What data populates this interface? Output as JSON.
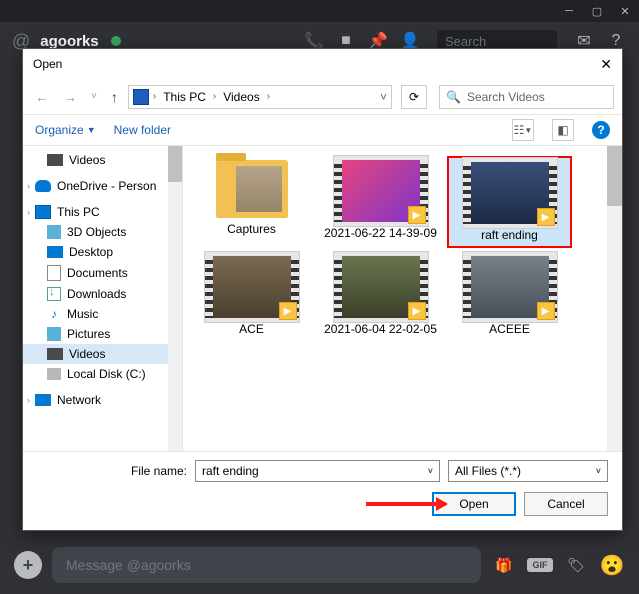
{
  "discord": {
    "username": "agoorks",
    "search_placeholder": "Search",
    "message_placeholder": "Message @agoorks",
    "gif_label": "GIF"
  },
  "dialog": {
    "title": "Open",
    "breadcrumbs": [
      "This PC",
      "Videos"
    ],
    "search_placeholder": "Search Videos",
    "toolbar": {
      "organize": "Organize",
      "new_folder": "New folder"
    },
    "tree": [
      {
        "label": "Videos",
        "icon": "vid",
        "indent": 1
      },
      {
        "label": "OneDrive - Person",
        "icon": "onedrive",
        "indent": 0,
        "exp": true
      },
      {
        "label": "This PC",
        "icon": "pc",
        "indent": 0,
        "exp": true
      },
      {
        "label": "3D Objects",
        "icon": "3d",
        "indent": 1
      },
      {
        "label": "Desktop",
        "icon": "desk",
        "indent": 1
      },
      {
        "label": "Documents",
        "icon": "doc",
        "indent": 1
      },
      {
        "label": "Downloads",
        "icon": "dl",
        "indent": 1
      },
      {
        "label": "Music",
        "icon": "music",
        "indent": 1
      },
      {
        "label": "Pictures",
        "icon": "pic",
        "indent": 1
      },
      {
        "label": "Videos",
        "icon": "vid",
        "indent": 1,
        "selected": true
      },
      {
        "label": "Local Disk (C:)",
        "icon": "disk",
        "indent": 1
      },
      {
        "label": "Network",
        "icon": "net",
        "indent": 0,
        "exp": true
      }
    ],
    "files": [
      {
        "label": "Captures",
        "type": "folder"
      },
      {
        "label": "2021-06-22 14-39-09",
        "type": "video",
        "thumb": "vid1"
      },
      {
        "label": "raft ending",
        "type": "video",
        "thumb": "vid2",
        "selected": true
      },
      {
        "label": "ACE",
        "type": "video",
        "thumb": "vid3"
      },
      {
        "label": "2021-06-04 22-02-05",
        "type": "video",
        "thumb": "vid4"
      },
      {
        "label": "ACEEE",
        "type": "video",
        "thumb": "vid5"
      }
    ],
    "filename_label": "File name:",
    "filename_value": "raft ending",
    "filter_value": "All Files (*.*)",
    "open_btn": "Open",
    "cancel_btn": "Cancel"
  }
}
